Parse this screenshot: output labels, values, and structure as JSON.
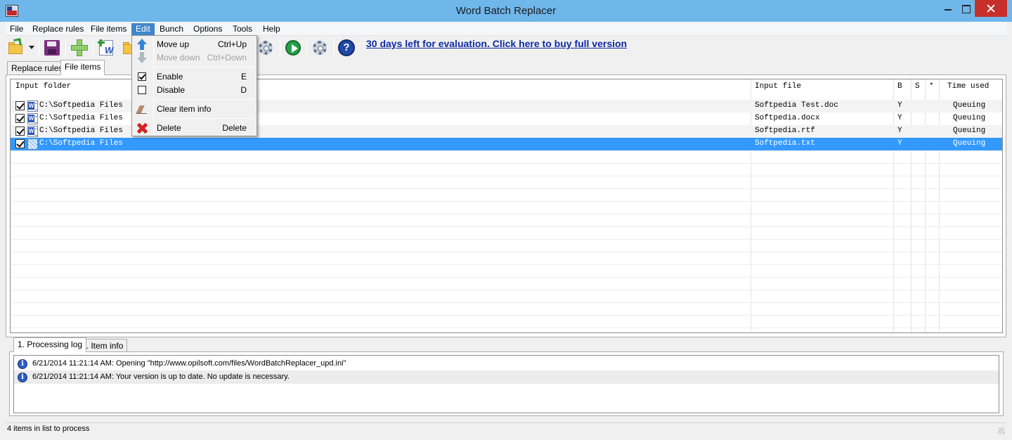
{
  "window": {
    "title": "Word Batch Replacer",
    "app_icon": "word-batch-replacer-logo"
  },
  "menubar": {
    "items": [
      {
        "label": "File"
      },
      {
        "label": "Replace rules"
      },
      {
        "label": "File items"
      },
      {
        "label": "Edit",
        "active": true
      },
      {
        "label": "Bunch"
      },
      {
        "label": "Options"
      },
      {
        "label": "Tools"
      },
      {
        "label": "Help"
      }
    ]
  },
  "toolbar": {
    "icons": [
      "open-folder-icon",
      "save-icon",
      "add-icon",
      "add-word-file-icon",
      "add-folder-icon",
      "settings-icon",
      "run-icon",
      "options-gear-icon",
      "help-icon"
    ],
    "evaluation_link": "30 days left for evaluation. Click here to buy full version"
  },
  "tabs": {
    "top": [
      {
        "label": "Replace rules"
      },
      {
        "label": "File items",
        "selected": true
      }
    ],
    "bottom": [
      {
        "label": "1. Processing log",
        "selected": true
      },
      {
        "label": "2. Item info"
      }
    ]
  },
  "file_table": {
    "columns": [
      "Input folder",
      "Input file",
      "B",
      "S",
      "*",
      "Time used"
    ],
    "rows": [
      {
        "checked": true,
        "icon": "word-doc-icon",
        "folder": "C:\\Softpedia Files",
        "file": "Softpedia Test.doc",
        "b": "Y",
        "s": "",
        "star": "",
        "time": "Queuing"
      },
      {
        "checked": true,
        "icon": "word-doc-icon",
        "folder": "C:\\Softpedia Files",
        "file": "Softpedia.docx",
        "b": "Y",
        "s": "",
        "star": "",
        "time": "Queuing"
      },
      {
        "checked": true,
        "icon": "word-doc-icon",
        "folder": "C:\\Softpedia Files",
        "file": "Softpedia.rtf",
        "b": "Y",
        "s": "",
        "star": "",
        "time": "Queuing"
      },
      {
        "checked": true,
        "icon": "text-file-icon",
        "folder": "C:\\Softpedia Files",
        "file": "Softpedia.txt",
        "b": "Y",
        "s": "",
        "star": "",
        "time": "Queuing",
        "selected": true
      }
    ]
  },
  "edit_menu": {
    "items": [
      {
        "label": "Move up",
        "shortcut": "Ctrl+Up",
        "icon": "arrow-up-icon",
        "enabled": true
      },
      {
        "label": "Move down",
        "shortcut": "Ctrl+Down",
        "icon": "arrow-down-icon",
        "enabled": false
      },
      {
        "label": "Enable",
        "shortcut": "E",
        "icon": "checked-box-icon",
        "enabled": true
      },
      {
        "label": "Disable",
        "shortcut": "D",
        "icon": "empty-box-icon",
        "enabled": true
      },
      {
        "label": "Clear item info",
        "shortcut": "",
        "icon": "eraser-icon",
        "enabled": true
      },
      {
        "label": "Delete",
        "shortcut": "Delete",
        "icon": "delete-x-icon",
        "enabled": true
      }
    ]
  },
  "log": {
    "entries": [
      {
        "icon": "info-icon",
        "text": "6/21/2014 11:21:14 AM: Opening \"http://www.opilsoft.com/files/WordBatchReplacer_upd.ini\""
      },
      {
        "icon": "info-icon",
        "text": "6/21/2014 11:21:14 AM: Your version is up to date. No update is necessary."
      }
    ]
  },
  "status": {
    "text": "4 items in list to process"
  }
}
